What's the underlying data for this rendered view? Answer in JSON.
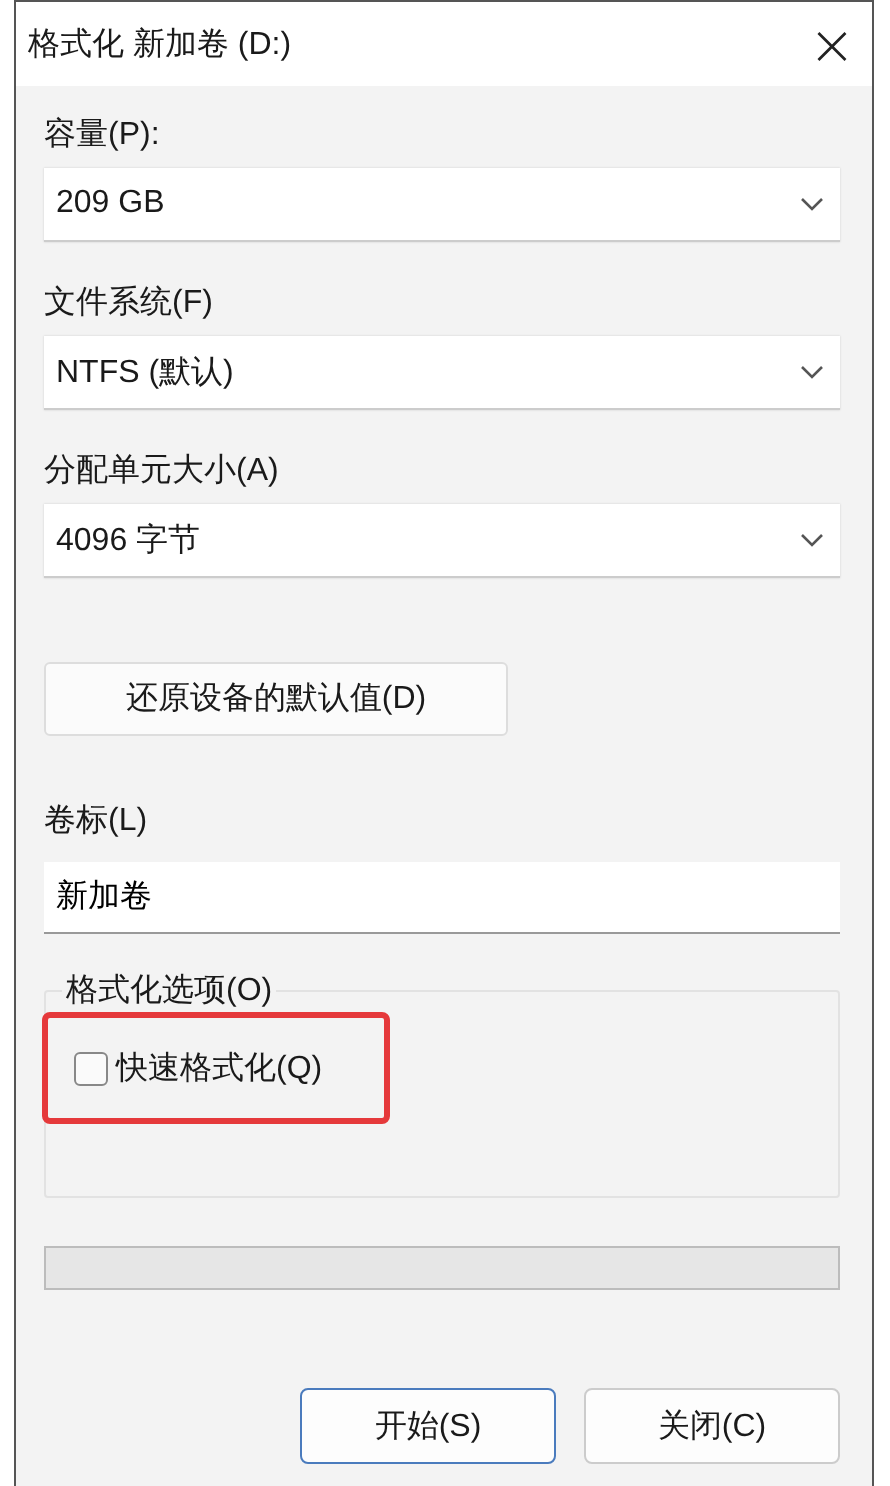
{
  "window": {
    "title": "格式化 新加卷 (D:)",
    "close": "×"
  },
  "fields": [
    {
      "label": "容量(P):",
      "value": "209 GB"
    },
    {
      "label": "文件系统(F)",
      "value": "NTFS (默认)"
    },
    {
      "label": "分配单元大小(A)",
      "value": "4096 字节"
    }
  ],
  "restore_button": "还原设备的默认值(D)",
  "volume_label": {
    "label": "卷标(L)",
    "value": "新加卷"
  },
  "options": {
    "title": "格式化选项(O)",
    "items": [
      {
        "label": "快速格式化(Q)",
        "checked": false,
        "highlighted": true
      }
    ]
  },
  "progress": {
    "level": 0
  },
  "buttons": [
    {
      "label": "开始(S)",
      "selected": true
    },
    {
      "label": "关闭(C)",
      "selected": false
    }
  ]
}
